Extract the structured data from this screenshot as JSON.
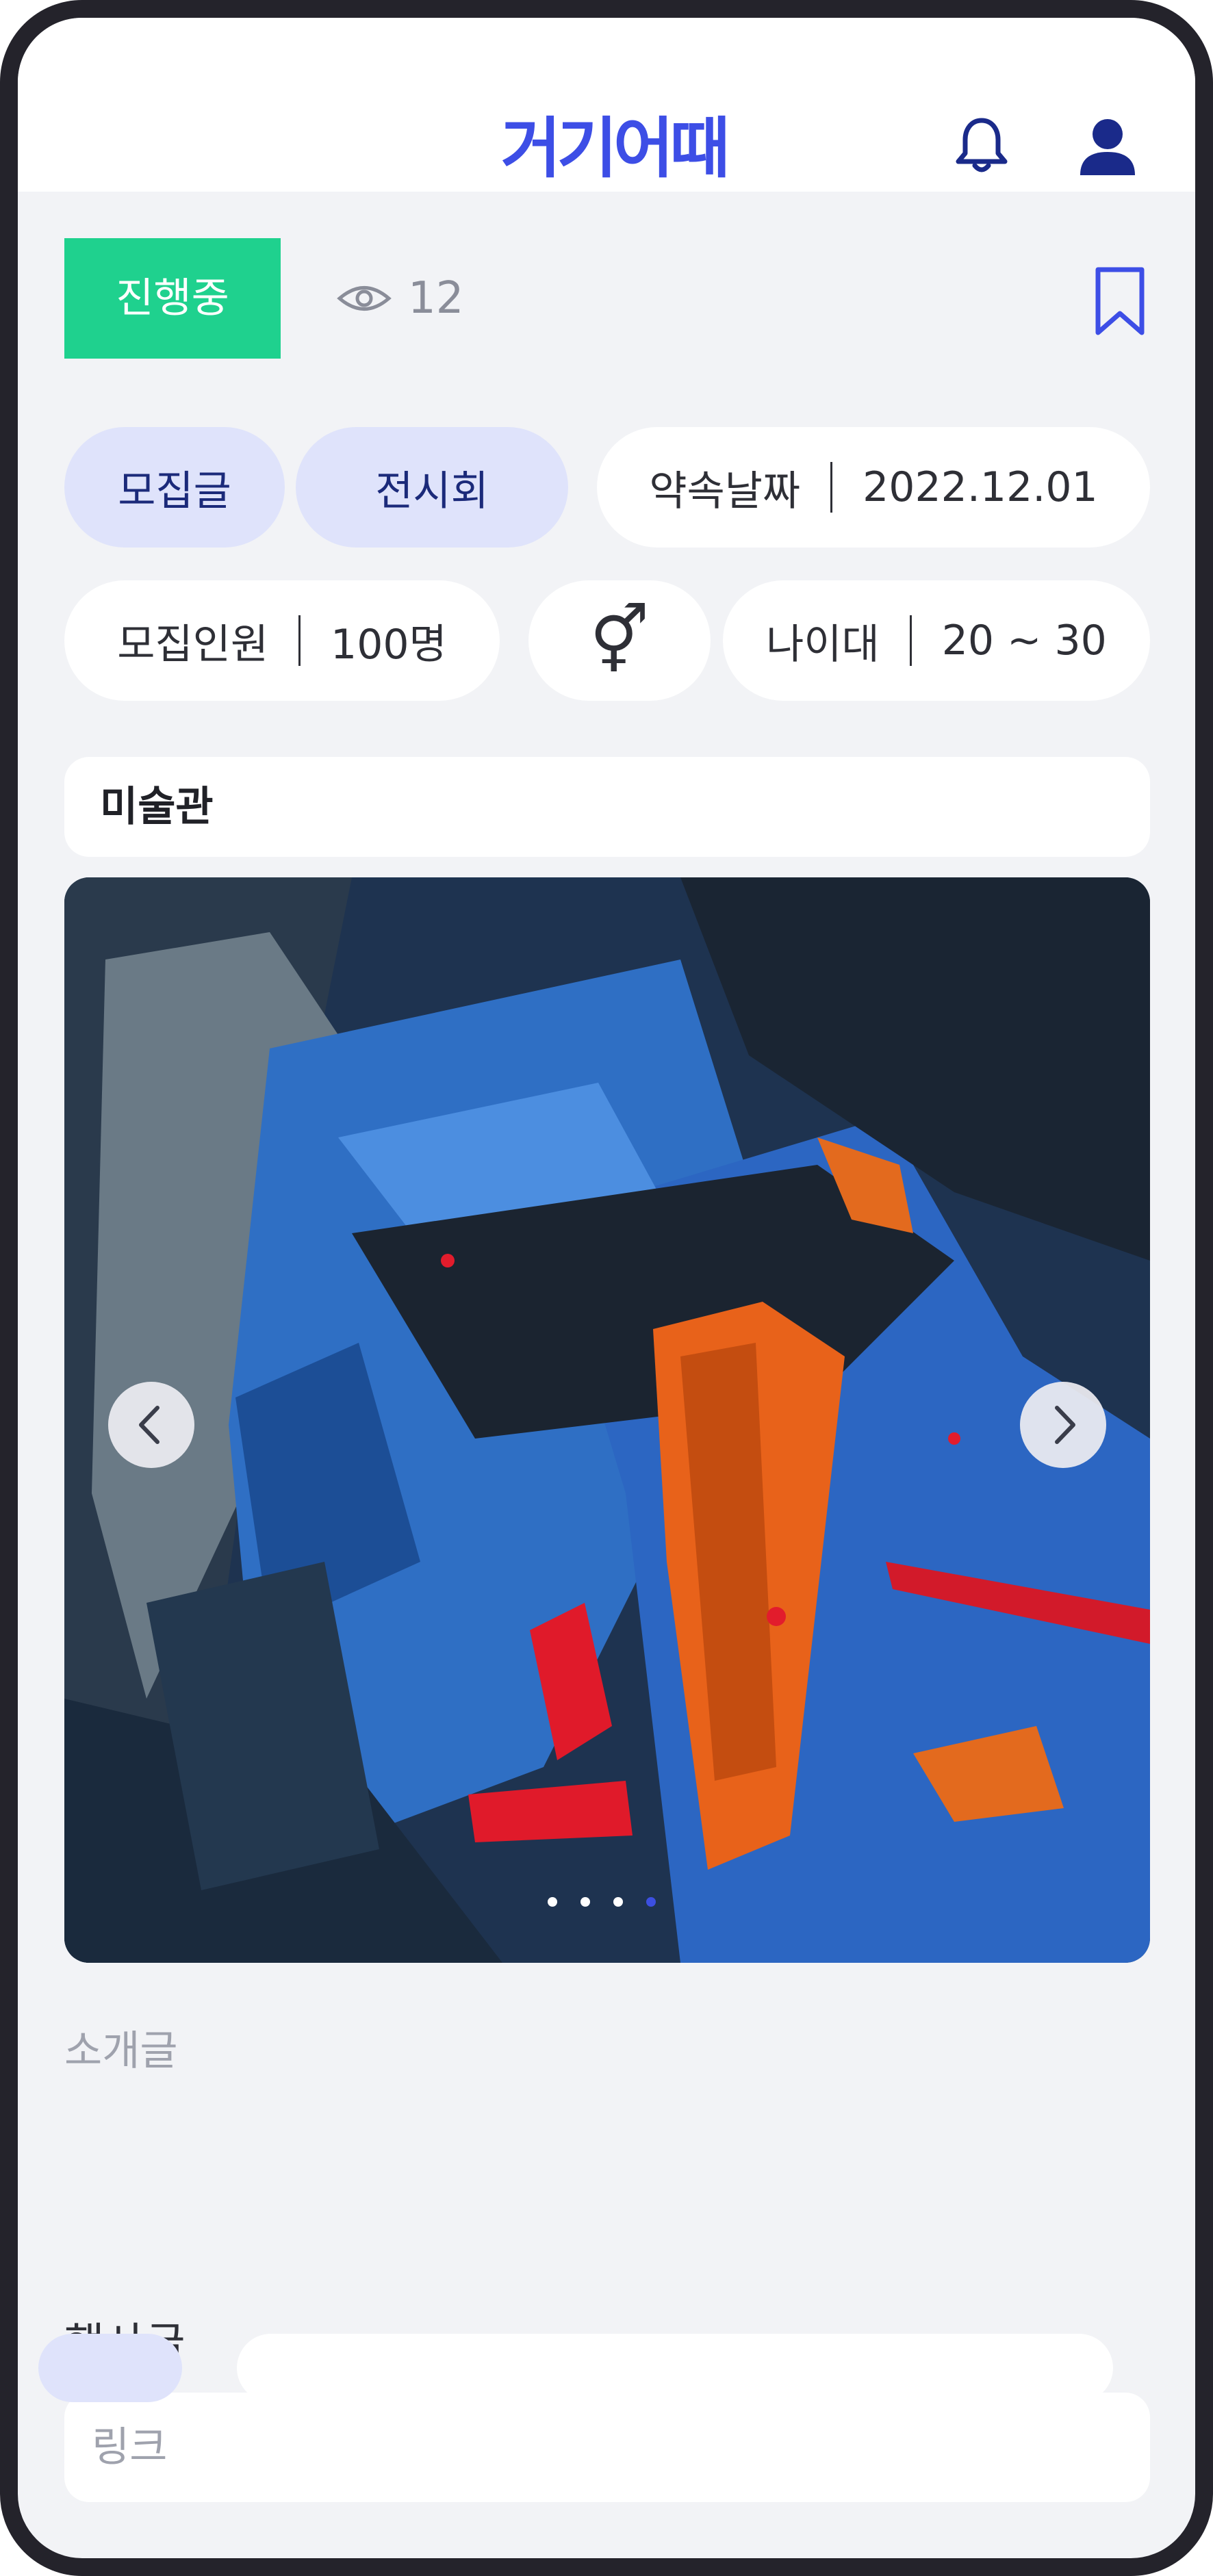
{
  "header": {
    "logo": "거기어때",
    "icons": [
      "bell-icon",
      "user-icon"
    ]
  },
  "post": {
    "status": "진행중",
    "views": "12",
    "tags": [
      "모집글",
      "전시회"
    ],
    "date_label": "약속날짜",
    "date_value": "2022.12.01",
    "recruit_label": "모집인원",
    "recruit_value": "100명",
    "gender_symbol": "⚥",
    "age_label": "나이대",
    "age_value": "20 ~ 30",
    "place": "미술관",
    "carousel": {
      "total": 4,
      "current": 4
    },
    "intro_placeholder": "소개글",
    "event_label": "행사글",
    "link_placeholder": "링크"
  },
  "colors": {
    "brand": "#3d4ee6",
    "status_green": "#1fd18e",
    "pill_blue": "#dfe3fb",
    "background": "#f2f3f6",
    "frame": "#24232b"
  }
}
